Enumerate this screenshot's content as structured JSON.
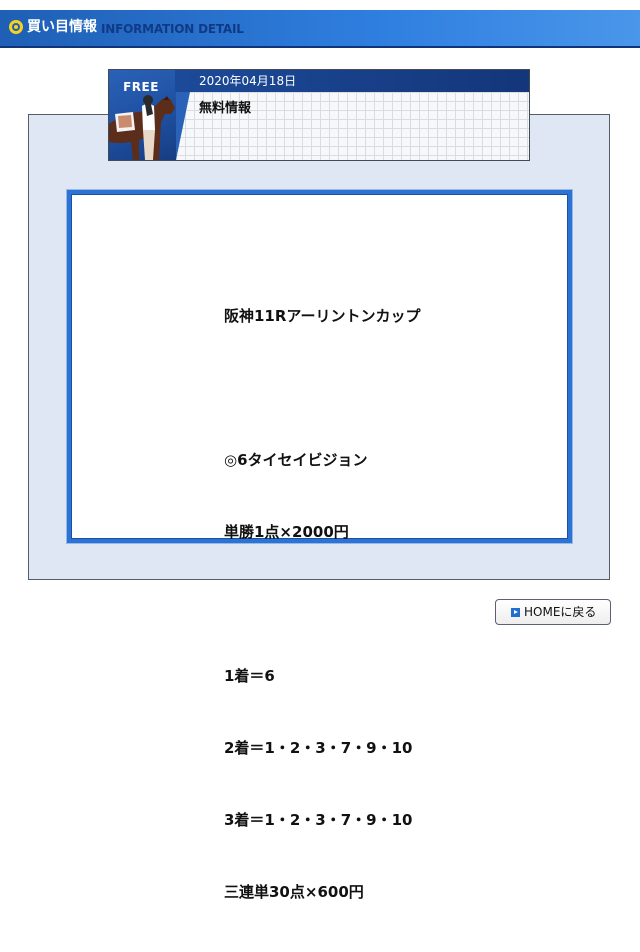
{
  "header": {
    "icon": "target-circle-icon",
    "title": "買い目情報",
    "subtitle": "INFORMATION DETAIL"
  },
  "info_card": {
    "badge": "FREE",
    "date": "2020年04月18日",
    "label": "無料情報",
    "image": "jockey-with-horse-illustration"
  },
  "content": {
    "lines": [
      "阪神11Rアーリントンカップ",
      "",
      "◎6タイセイビジョン",
      "単勝1点×2000円",
      "",
      "1着＝6",
      "2着＝1・2・3・7・9・10",
      "3着＝1・2・3・7・9・10",
      "三連単30点×600円"
    ]
  },
  "home_button": {
    "icon": "play-arrow-icon",
    "label": "HOMEに戻る"
  },
  "colors": {
    "header_blue": "#2f7fe0",
    "card_navy": "#1c4a98",
    "content_border": "#2b73d4",
    "panel_bg": "#dfe7f4",
    "header_icon": "#f7d21c"
  }
}
